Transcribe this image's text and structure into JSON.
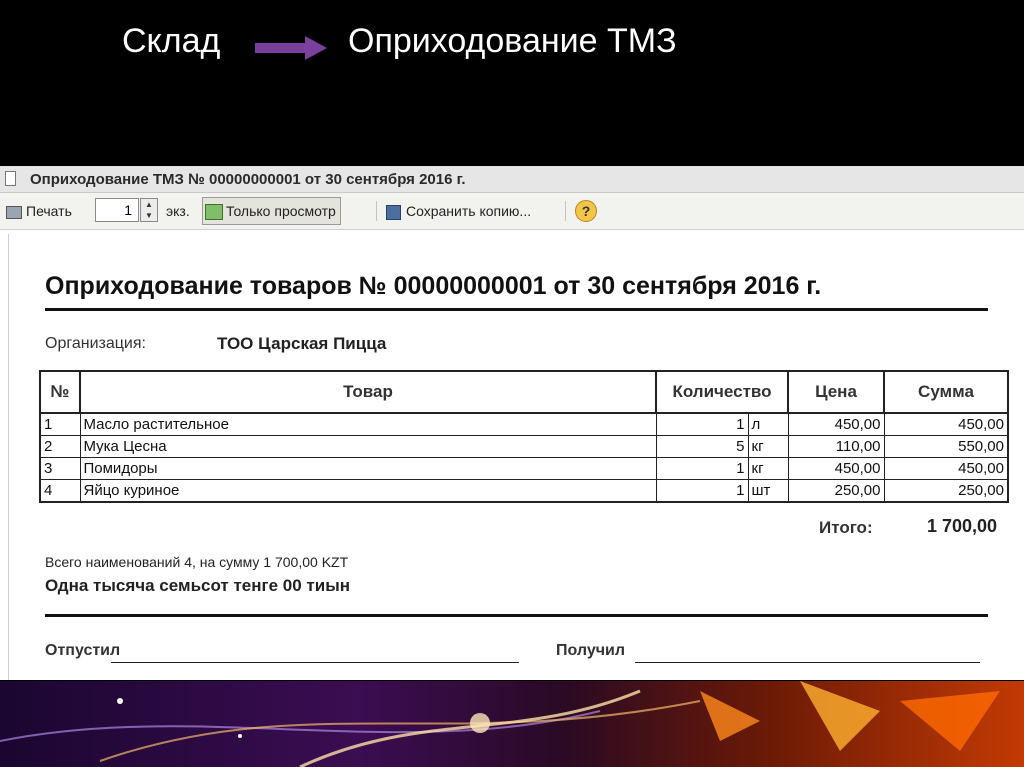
{
  "slide": {
    "from": "Склад",
    "to": "Оприходование ТМЗ"
  },
  "window": {
    "title": "Оприходование ТМЗ № 00000000001 от 30 сентября 2016 г."
  },
  "toolbar": {
    "print_label": "Печать",
    "copies_value": "1",
    "copies_unit": "экз.",
    "view_only_label": "Только просмотр",
    "save_copy_label": "Сохранить копию...",
    "help_label": "?"
  },
  "document": {
    "heading": "Оприходование товаров № 00000000001 от 30 сентября 2016 г.",
    "org_label": "Организация:",
    "org_value": "ТОО Царская Пицца",
    "table": {
      "headers": [
        "№",
        "Товар",
        "Количество",
        "Цена",
        "Сумма"
      ],
      "rows": [
        {
          "n": "1",
          "item": "Масло растительное",
          "qty": "1",
          "unit": "л",
          "price": "450,00",
          "sum": "450,00"
        },
        {
          "n": "2",
          "item": "Мука Цесна",
          "qty": "5",
          "unit": "кг",
          "price": "110,00",
          "sum": "550,00"
        },
        {
          "n": "3",
          "item": "Помидоры",
          "qty": "1",
          "unit": "кг",
          "price": "450,00",
          "sum": "450,00"
        },
        {
          "n": "4",
          "item": "Яйцо куриное",
          "qty": "1",
          "unit": "шт",
          "price": "250,00",
          "sum": "250,00"
        }
      ]
    },
    "total_label": "Итого:",
    "total_value": "1 700,00",
    "summary": "Всего наименований 4, на сумму 1 700,00 KZT",
    "amount_words": "Одна тысяча семьсот тенге 00 тиын",
    "released_label": "Отпустил",
    "received_label": "Получил"
  },
  "colors": {
    "arrow": "#7b3f9e",
    "toolbar_bg": "#f2f2ee",
    "titlebar_bg": "#e6e6e6"
  }
}
